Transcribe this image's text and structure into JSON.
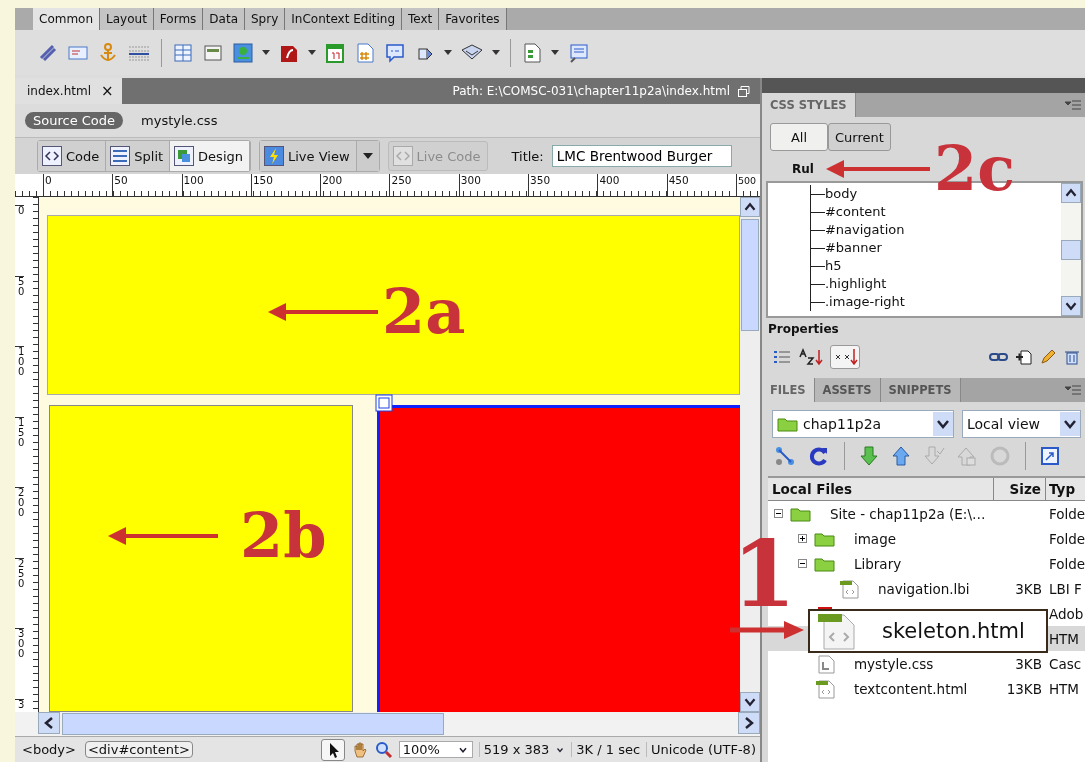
{
  "insert_bar": {
    "tabs": [
      {
        "label": "Common",
        "selected": true
      },
      {
        "label": "Layout",
        "selected": false
      },
      {
        "label": "Forms",
        "selected": false
      },
      {
        "label": "Data",
        "selected": false
      },
      {
        "label": "Spry",
        "selected": false
      },
      {
        "label": "InContext Editing",
        "selected": false
      },
      {
        "label": "Text",
        "selected": false
      },
      {
        "label": "Favorites",
        "selected": false
      }
    ]
  },
  "document": {
    "tab": {
      "filename": "index.html",
      "close": "×",
      "selected": true
    },
    "path": "Path:  E:\\COMSC-031\\chapter11p2a\\index.html"
  },
  "related_files": [
    {
      "label": "Source Code",
      "selected": true
    },
    {
      "label": "mystyle.css",
      "selected": false
    }
  ],
  "document_toolbar": {
    "views": [
      {
        "label": "Code",
        "selected": false
      },
      {
        "label": "Split",
        "selected": false
      },
      {
        "label": "Design",
        "selected": true
      }
    ],
    "live_view": {
      "label": "Live View",
      "selected": false
    },
    "live_code": {
      "label": "Live Code",
      "disabled": true
    },
    "title_label": "Title:",
    "title_value": "LMC Brentwood Burger"
  },
  "rulers": {
    "horizontal": [
      "0",
      "50",
      "100",
      "150",
      "200",
      "250",
      "300",
      "350",
      "400",
      "450",
      "500"
    ],
    "vertical": [
      "0",
      "50",
      "100",
      "150",
      "200",
      "250",
      "300",
      "3"
    ]
  },
  "status_bar": {
    "tags": [
      {
        "label": "<body>",
        "selected": false
      },
      {
        "label": "<div#content>",
        "selected": true
      }
    ],
    "zoom": "100%",
    "window_size": "519 x 383",
    "download": "3K / 1 sec",
    "encoding": "Unicode (UTF-8)"
  },
  "css_styles": {
    "panel_tab": "CSS STYLES",
    "modes": [
      {
        "label": "All",
        "selected": true
      },
      {
        "label": "Current",
        "selected": false
      }
    ],
    "rules_heading": "Rul",
    "rules": [
      "body",
      "#content",
      "#navigation",
      "#banner",
      "h5",
      ".highlight",
      ".image-right"
    ],
    "properties_heading": "Properties"
  },
  "files": {
    "tabs": [
      {
        "label": "FILES",
        "selected": true
      },
      {
        "label": "ASSETS",
        "selected": false
      },
      {
        "label": "SNIPPETS",
        "selected": false
      }
    ],
    "site": "chap11p2a",
    "view": "Local view",
    "columns": [
      "Local Files",
      "Size",
      "Typ"
    ],
    "tree": [
      {
        "name": "Site - chap11p2a (E:\\…",
        "type": "Folde",
        "kind": "folder",
        "expanded": true,
        "selected": false,
        "children": [
          {
            "name": "image",
            "type": "Folde",
            "kind": "folder",
            "expanded": false,
            "selected": false
          },
          {
            "name": "Library",
            "type": "Folde",
            "kind": "folder",
            "expanded": true,
            "selected": false,
            "children": [
              {
                "name": "navigation.lbi",
                "size": "3KB",
                "type": "LBI F",
                "kind": "lbi",
                "selected": false
              }
            ]
          },
          {
            "type": "Adob",
            "kind": "pdf",
            "selected": false
          },
          {
            "type": "HTM",
            "kind": "none",
            "selected": true
          },
          {
            "name": "mystyle.css",
            "size": "3KB",
            "type": "Casc",
            "kind": "css",
            "selected": false
          },
          {
            "name": "textcontent.html",
            "size": "13KB",
            "type": "HTM",
            "kind": "html",
            "selected": false
          }
        ]
      }
    ],
    "drag_item": "skeleton.html"
  },
  "annotations": [
    {
      "label": "2a"
    },
    {
      "label": "2b"
    },
    {
      "label": "2c"
    },
    {
      "label": "1"
    }
  ]
}
